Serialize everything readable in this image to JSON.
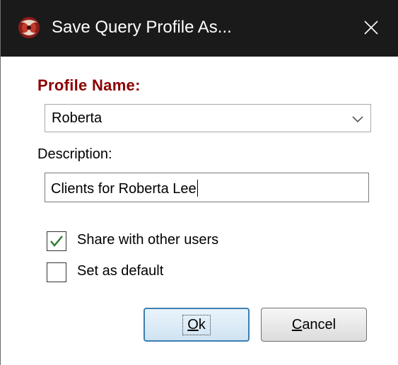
{
  "window": {
    "title": "Save Query Profile As...",
    "icon": "app-logo-icon",
    "close_icon": "close-icon"
  },
  "form": {
    "profile_name_label": "Profile Name:",
    "profile_name_value": "Roberta",
    "description_label": "Description:",
    "description_value": "Clients for Roberta Lee",
    "share_label": "Share with other users",
    "share_checked": true,
    "default_label": "Set as default",
    "default_checked": false
  },
  "buttons": {
    "ok_mnemonic": "O",
    "ok_rest": "k",
    "cancel_mnemonic": "C",
    "cancel_rest": "ancel"
  },
  "colors": {
    "titlebar": "#1a1a1a",
    "profile_label": "#8b0000",
    "check": "#2e7d32",
    "default_button_border": "#3c7fb1"
  }
}
